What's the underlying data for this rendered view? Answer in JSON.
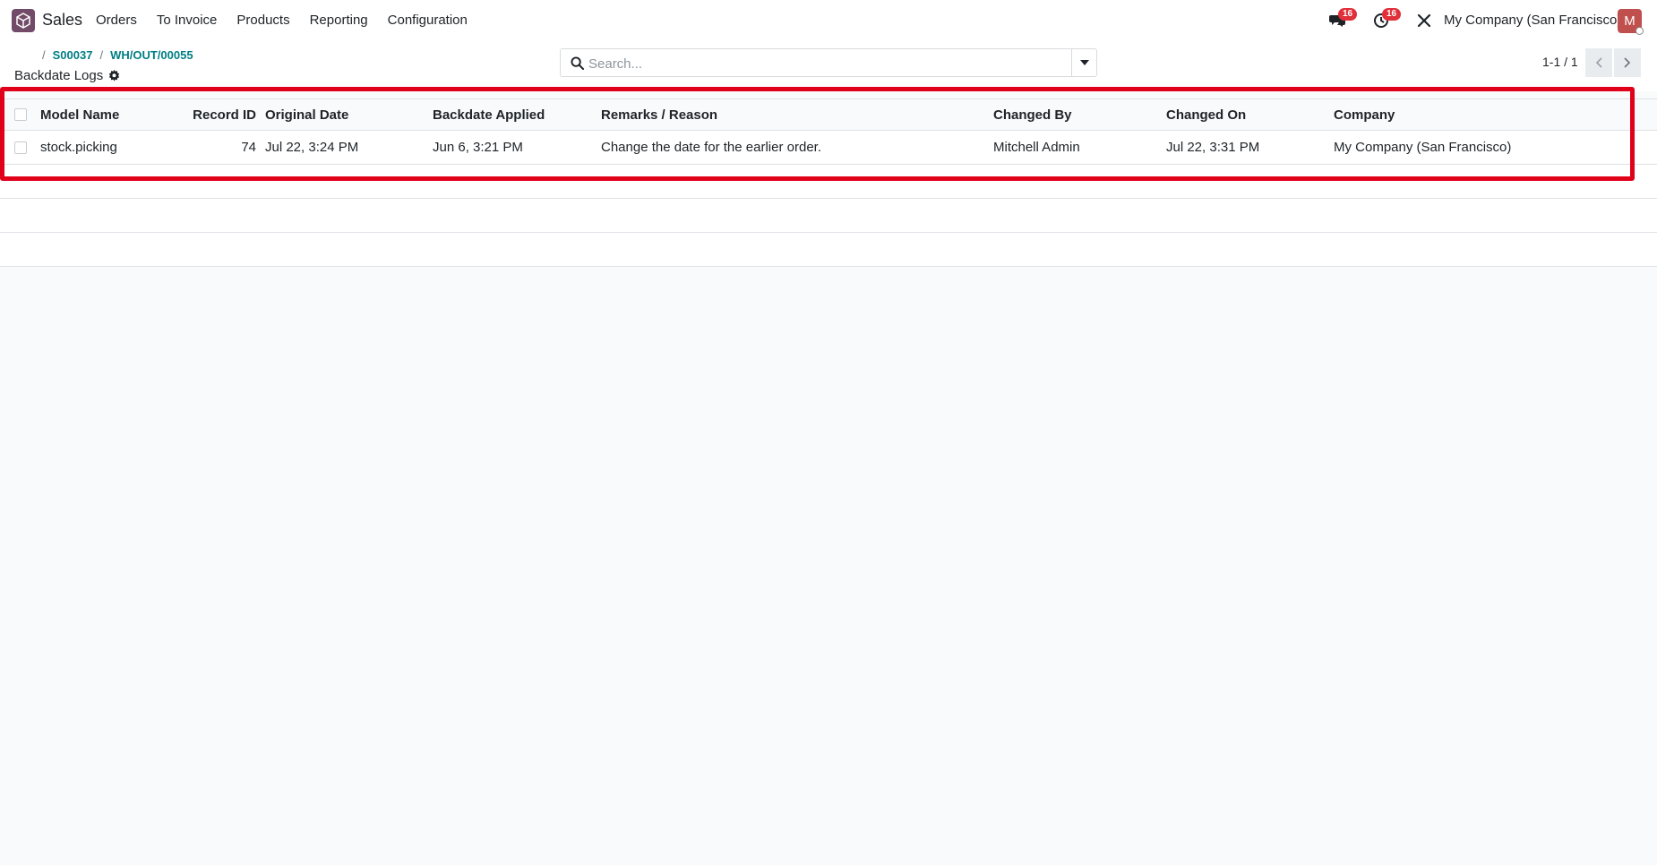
{
  "navbar": {
    "app_name": "Sales",
    "menu": [
      "Orders",
      "To Invoice",
      "Products",
      "Reporting",
      "Configuration"
    ],
    "messages_badge": "16",
    "activities_badge": "16",
    "company": "My Company (San Francisco)",
    "avatar_initial": "M"
  },
  "control_panel": {
    "breadcrumb_sep": "/",
    "breadcrumbs": [
      "S00037",
      "WH/OUT/00055"
    ],
    "title": "Backdate Logs",
    "search_placeholder": "Search...",
    "pager": "1-1 / 1"
  },
  "table": {
    "columns": [
      "Model Name",
      "Record ID",
      "Original Date",
      "Backdate Applied",
      "Remarks / Reason",
      "Changed By",
      "Changed On",
      "Company"
    ],
    "rows": [
      {
        "model_name": "stock.picking",
        "record_id": "74",
        "original_date": "Jul 22, 3:24 PM",
        "backdate_applied": "Jun 6, 3:21 PM",
        "remarks": "Change the date for the earlier order.",
        "changed_by": "Mitchell Admin",
        "changed_on": "Jul 22, 3:31 PM",
        "company": "My Company (San Francisco)"
      }
    ]
  },
  "colors": {
    "brand": "#714b67",
    "link": "#017e84",
    "badge": "#e0303a",
    "highlight": "#e1001a"
  }
}
